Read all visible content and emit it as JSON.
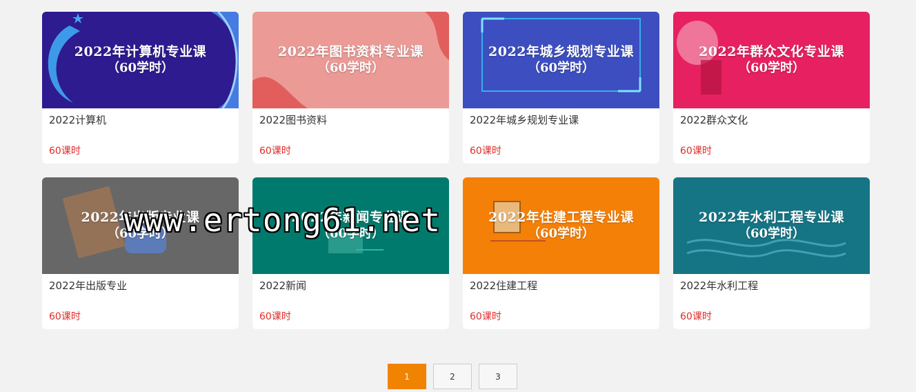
{
  "courses": [
    {
      "banner_title": "2022年计算机专业课",
      "banner_sub": "（60学时）",
      "name": "2022计算机",
      "hours": "60课时",
      "color": "#2e1b8f"
    },
    {
      "banner_title": "2022年图书资料专业课",
      "banner_sub": "（60学时）",
      "name": "2022图书资料",
      "hours": "60课时",
      "color": "#eb9a96"
    },
    {
      "banner_title": "2022年城乡规划专业课",
      "banner_sub": "（60学时）",
      "name": "2022年城乡规划专业课",
      "hours": "60课时",
      "color": "#3d4fc0"
    },
    {
      "banner_title": "2022年群众文化专业课",
      "banner_sub": "（60学时）",
      "name": "2022群众文化",
      "hours": "60课时",
      "color": "#e62061"
    },
    {
      "banner_title": "2022年出版专业课",
      "banner_sub": "（60学时）",
      "name": "2022年出版专业",
      "hours": "60课时",
      "color": "#676767"
    },
    {
      "banner_title": "2022年新闻专业课",
      "banner_sub": "（60学时）",
      "name": "2022新闻",
      "hours": "60课时",
      "color": "#007a6c"
    },
    {
      "banner_title": "2022年住建工程专业课",
      "banner_sub": "（60学时）",
      "name": "2022住建工程",
      "hours": "60课时",
      "color": "#f58007"
    },
    {
      "banner_title": "2022年水利工程专业课",
      "banner_sub": "（60学时）",
      "name": "2022年水利工程",
      "hours": "60课时",
      "color": "#167585"
    }
  ],
  "pagination": {
    "pages": [
      "1",
      "2",
      "3"
    ],
    "active": "1"
  },
  "watermark": "www.ertong61.net"
}
